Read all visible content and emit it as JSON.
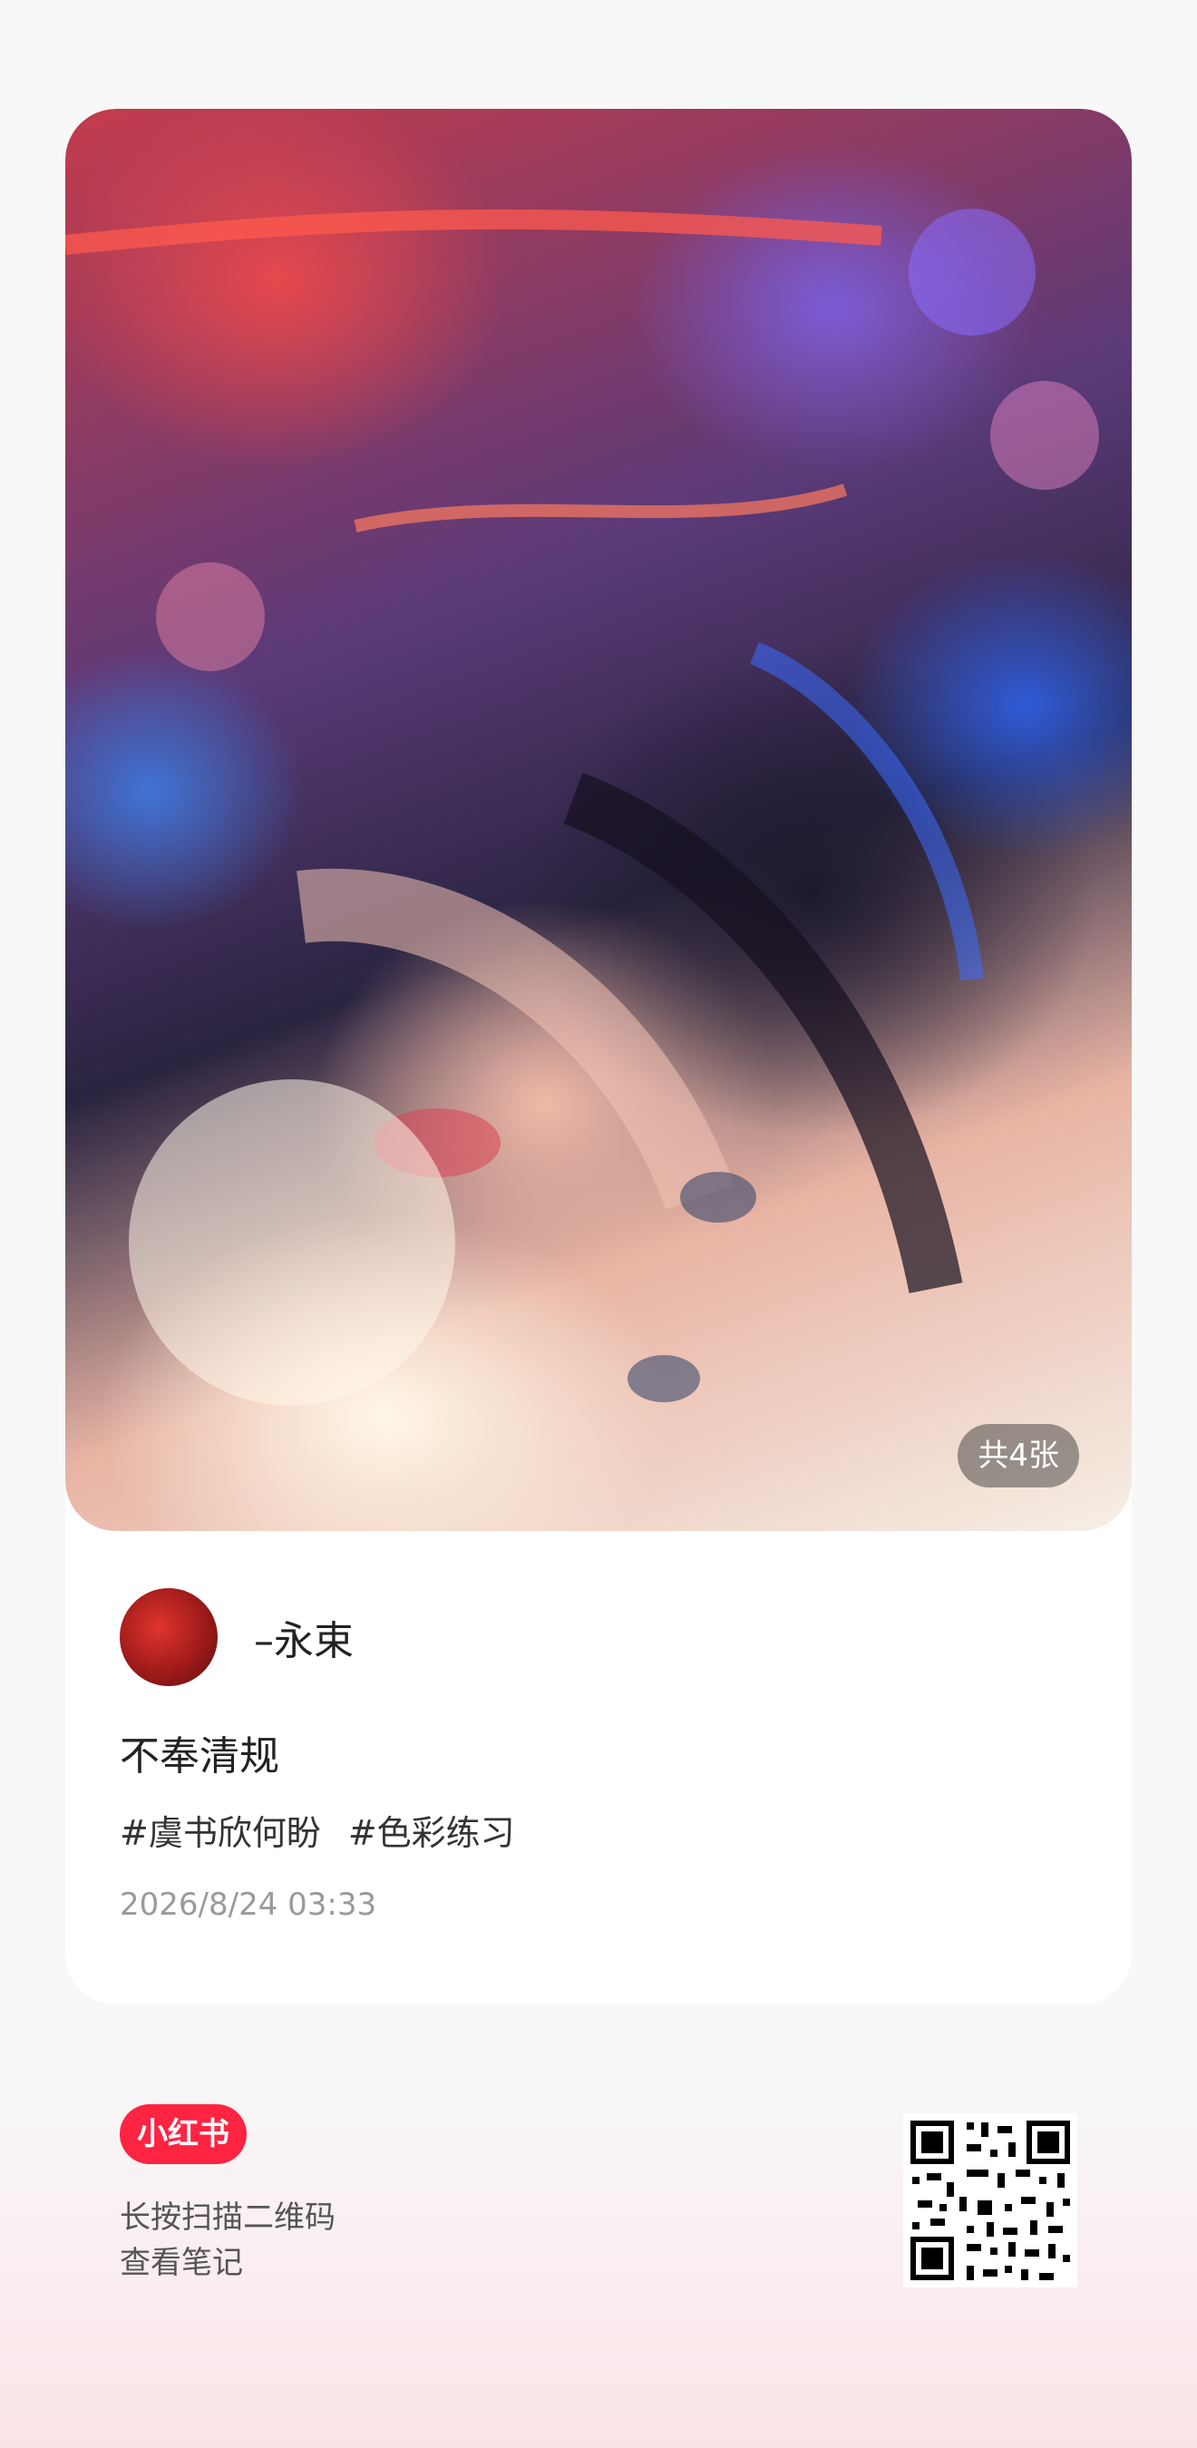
{
  "post": {
    "photo_count": "共4张",
    "author_name": "–永束",
    "title": "不奉清规",
    "tags": [
      "#虞书欣何盼",
      "#色彩练习"
    ],
    "date": "2026/8/24 03:33"
  },
  "footer": {
    "brand": "小红书",
    "hint_line1": "长按扫描二维码",
    "hint_line2": "查看笔记"
  },
  "colors": {
    "brand_red": "#ff2442",
    "background": "#f8f8f8",
    "footer_pink": "#fbe4e8",
    "text_primary": "#222222",
    "text_secondary": "#9a9a9a"
  }
}
